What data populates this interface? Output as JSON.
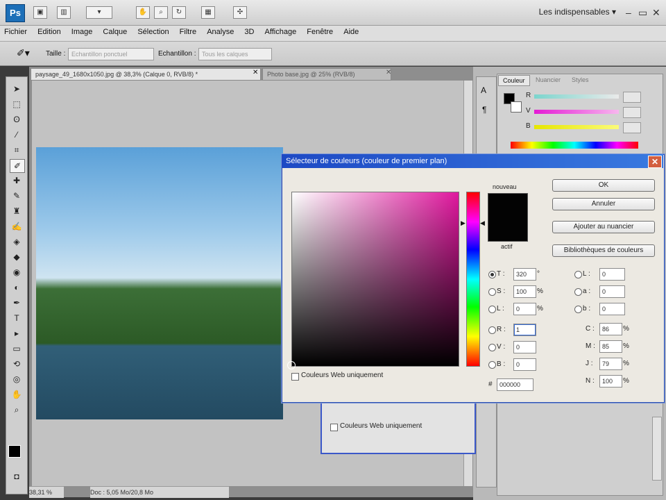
{
  "app": {
    "logo": "Ps",
    "workspace": "Les indispensables ▾",
    "win_min": "–",
    "win_max": "▭",
    "win_close": "✕"
  },
  "menu": [
    "Fichier",
    "Edition",
    "Image",
    "Calque",
    "Sélection",
    "Filtre",
    "Analyse",
    "3D",
    "Affichage",
    "Fenêtre",
    "Aide"
  ],
  "options": {
    "size_label": "Taille :",
    "size_value": "Echantillon ponctuel",
    "sample_label": "Echantillon :",
    "sample_value": "Tous les calques"
  },
  "doc": {
    "tab1": "paysage_49_1680x1050.jpg @ 38,3% (Calque 0, RVB/8) *",
    "tab2": "Photo base.jpg @ 25% (RVB/8)",
    "zoom": "38,31 %",
    "doc_info": "Doc : 5,05 Mo/20,8 Mo"
  },
  "panels": {
    "tab_couleur": "Couleur",
    "tab_nuancier": "Nuancier",
    "tab_styles": "Styles",
    "slider_r": "R",
    "slider_v": "V",
    "slider_b": "B"
  },
  "behind": {
    "web_label": "Couleurs Web uniquement"
  },
  "dialog": {
    "title": "Sélecteur de couleurs (couleur de premier plan)",
    "new_label": "nouveau",
    "current_label": "actif",
    "ok": "OK",
    "cancel": "Annuler",
    "add_swatch": "Ajouter au nuancier",
    "libraries": "Bibliothèques de couleurs",
    "web_only": "Couleurs Web uniquement",
    "hsb": [
      {
        "label": "T :",
        "value": "320",
        "unit": "°"
      },
      {
        "label": "S :",
        "value": "100",
        "unit": "%"
      },
      {
        "label": "L :",
        "value": "0",
        "unit": "%"
      }
    ],
    "rgb": [
      {
        "label": "R :",
        "value": "1"
      },
      {
        "label": "V :",
        "value": "0"
      },
      {
        "label": "B :",
        "value": "0"
      }
    ],
    "lab": [
      {
        "label": "L :",
        "value": "0"
      },
      {
        "label": "a :",
        "value": "0"
      },
      {
        "label": "b :",
        "value": "0"
      }
    ],
    "cmyk": [
      {
        "label": "C :",
        "value": "86",
        "unit": "%"
      },
      {
        "label": "M :",
        "value": "85",
        "unit": "%"
      },
      {
        "label": "J :",
        "value": "79",
        "unit": "%"
      },
      {
        "label": "N :",
        "value": "100",
        "unit": "%"
      }
    ],
    "hex_label": "#",
    "hex": "000000"
  },
  "colors": {
    "accent": "#1d49c4",
    "selected_color": "#030303"
  }
}
